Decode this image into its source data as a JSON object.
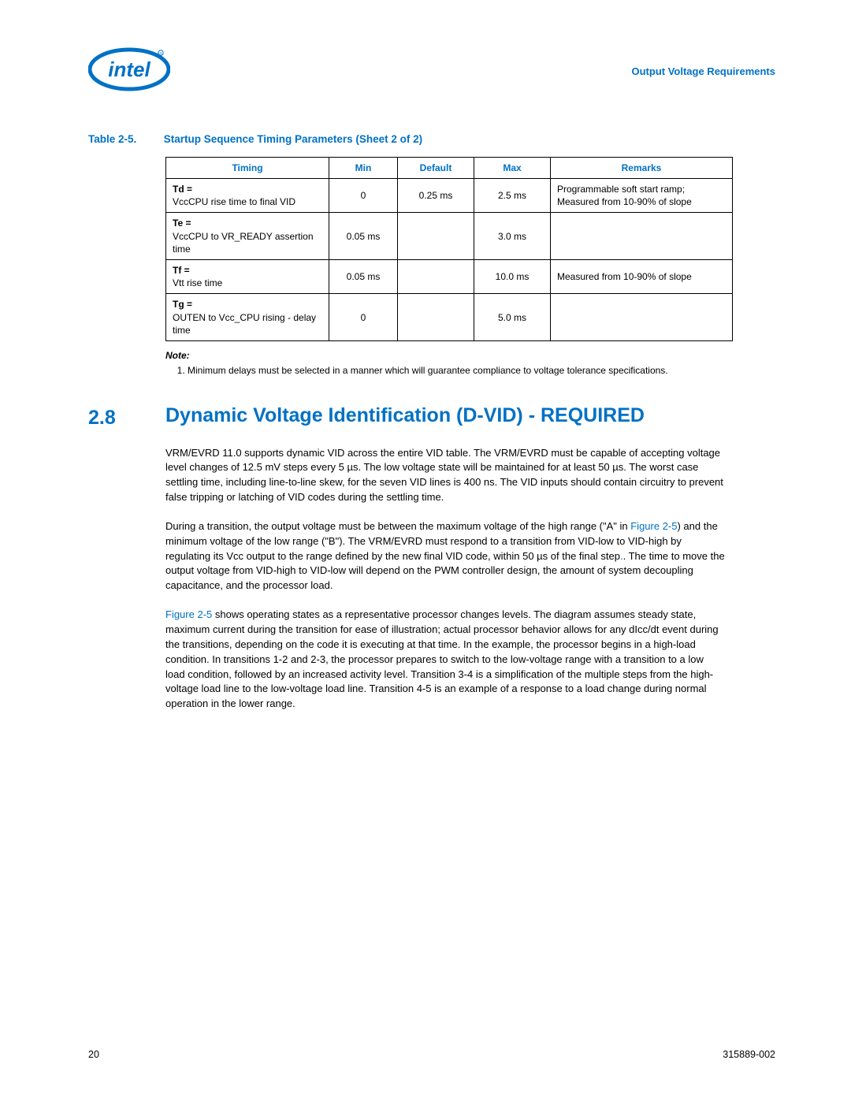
{
  "header": {
    "running_title": "Output Voltage Requirements"
  },
  "table": {
    "label_num": "Table 2-5.",
    "label_text": "Startup Sequence Timing Parameters  (Sheet 2 of 2)",
    "headers": {
      "timing": "Timing",
      "min": "Min",
      "default": "Default",
      "max": "Max",
      "remarks": "Remarks"
    },
    "rows": [
      {
        "sym": "Td =",
        "desc": "VccCPU rise time to final VID",
        "min": "0",
        "default": "0.25 ms",
        "max": "2.5 ms",
        "remarks": "Programmable soft start ramp; Measured from 10-90% of slope"
      },
      {
        "sym": "Te =",
        "desc": "VccCPU to VR_READY assertion time",
        "min": "0.05 ms",
        "default": "",
        "max": "3.0 ms",
        "remarks": ""
      },
      {
        "sym": "Tf =",
        "desc": "Vtt rise time",
        "min": "0.05 ms",
        "default": "",
        "max": "10.0 ms",
        "remarks": "Measured from 10-90% of slope"
      },
      {
        "sym": "Tg =",
        "desc": "OUTEN to Vcc_CPU rising - delay time",
        "min": "0",
        "default": "",
        "max": "5.0 ms",
        "remarks": ""
      }
    ]
  },
  "note": {
    "head": "Note:",
    "item1": "Minimum delays must be selected in a manner which will guarantee compliance to voltage tolerance specifications."
  },
  "section": {
    "num": "2.8",
    "title": "Dynamic Voltage Identification (D-VID) - REQUIRED",
    "p1": "VRM/EVRD 11.0 supports dynamic VID across the entire VID table. The VRM/EVRD must be capable of accepting voltage level changes of 12.5 mV steps every 5 µs. The low voltage state will be maintained for at least 50 µs. The worst case settling time, including line-to-line skew, for the seven VID lines is 400 ns. The VID inputs should contain circuitry to prevent false tripping or latching of VID codes during the settling time.",
    "p2a": "During a transition, the output voltage must be between the maximum voltage of the high range (\"A\" in ",
    "figref": "Figure 2-5",
    "p2b": ") and the minimum voltage of the low range (\"B\"). The VRM/EVRD must respond to a transition from VID-low to VID-high by regulating its Vcc output to the range defined by the new final VID code, within 50 µs of the final step",
    "p2c": ". The time to move the output voltage from VID-high to VID-low will depend on the PWM controller design, the amount of system decoupling capacitance, and the processor load.",
    "p3a": " shows operating states as a representative processor changes levels. The diagram assumes steady state, maximum current during the transition for ease of illustration; actual processor behavior allows for any dIcc/dt event during the transitions, depending on the code it is executing at that time. In the example, the processor begins in a high-load condition. In transitions 1-2 and 2-3, the processor prepares to switch to the low-voltage range with a transition to a low load condition, followed by an increased activity level. Transition 3-4 is a simplification of the multiple steps from the high-voltage load line to the low-voltage load line. Transition 4-5 is an example of a response to a load change during normal operation in the lower range."
  },
  "footer": {
    "page": "20",
    "doc": "315889-002"
  }
}
